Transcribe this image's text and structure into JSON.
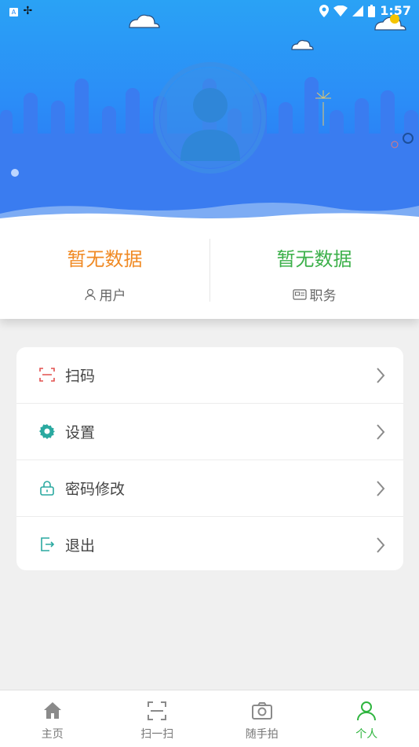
{
  "status_bar": {
    "time": "1:57"
  },
  "stats": {
    "left": {
      "value": "暂无数据",
      "label": "用户",
      "color": "#f08a24"
    },
    "right": {
      "value": "暂无数据",
      "label": "职务",
      "color": "#3cb04a"
    }
  },
  "menu": {
    "items": [
      {
        "label": "扫码",
        "icon": "scan-icon"
      },
      {
        "label": "设置",
        "icon": "gear-icon"
      },
      {
        "label": "密码修改",
        "icon": "lock-icon"
      },
      {
        "label": "退出",
        "icon": "logout-icon"
      }
    ]
  },
  "tabbar": {
    "tabs": [
      {
        "label": "主页",
        "icon": "home-icon"
      },
      {
        "label": "扫一扫",
        "icon": "scan-icon"
      },
      {
        "label": "随手拍",
        "icon": "camera-icon"
      },
      {
        "label": "个人",
        "icon": "person-icon",
        "active": true
      }
    ]
  },
  "colors": {
    "accent": "#2fb53f",
    "banner": "#2b8df7",
    "orange": "#f08a24"
  }
}
